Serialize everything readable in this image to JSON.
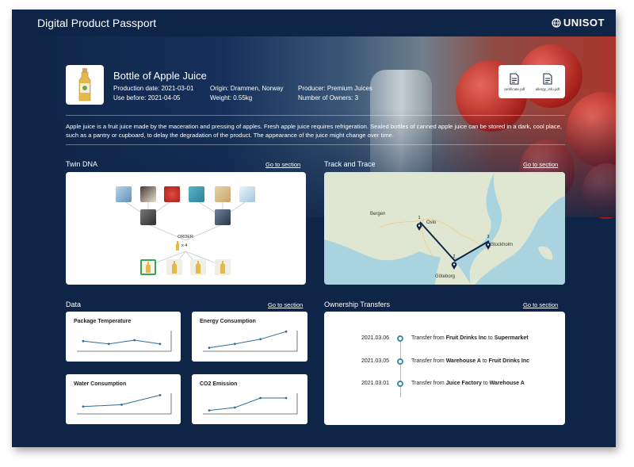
{
  "header": {
    "title": "Digital Product Passport",
    "brand": "UNISOT"
  },
  "product": {
    "name": "Bottle of Apple Juice",
    "production_date": "Production date: 2021-03-01",
    "use_before": "Use before: 2021-04-05",
    "origin": "Origin: Drammen, Norway",
    "weight": "Weight: 0.55kg",
    "producer": "Producer: Premium Juices",
    "owners": "Number of Owners: 3",
    "documents": [
      {
        "label": "certificate.pdf"
      },
      {
        "label": "allergy_info.pdf"
      }
    ],
    "description": "Apple juice is a fruit juice made by the maceration and pressing of apples. Fresh apple juice requires refrigeration. Sealed bottles of canned apple juice can be stored in a dark, cool place, such as a pantry or cupboard, to delay the degradation of the product. The appearance of the juice might change over time."
  },
  "twin_dna": {
    "title": "Twin DNA",
    "link": "Go to section",
    "order_label": "ORDER",
    "order_qty": "x 4"
  },
  "track": {
    "title": "Track and Trace",
    "link": "Go to section",
    "places": {
      "bergen": "Bergen",
      "oslo": "Oslo",
      "stockholm": "Stockholm",
      "goteborg": "Göteborg"
    },
    "stops": [
      "1",
      "2",
      "3"
    ]
  },
  "data_section": {
    "title": "Data",
    "link": "Go to section",
    "cards": [
      {
        "title": "Package Temperature",
        "values": [
          0.45,
          0.3,
          0.5,
          0.3
        ]
      },
      {
        "title": "Energy Consumption",
        "values": [
          0.1,
          0.3,
          0.55,
          0.95
        ]
      },
      {
        "title": "Water Consumption",
        "values": [
          0.3,
          0.4,
          0.9
        ]
      },
      {
        "title": "CO2 Emission",
        "values": [
          0.1,
          0.25,
          0.75,
          0.75
        ]
      }
    ]
  },
  "ownership": {
    "title": "Ownership Transfers",
    "link": "Go to section",
    "rows": [
      {
        "date": "2021.03.06",
        "prefix": "Transfer from ",
        "from": "Fruit Drinks Inc",
        "mid": " to ",
        "to": "Supermarket"
      },
      {
        "date": "2021.03.05",
        "prefix": "Transfer from ",
        "from": "Warehouse A",
        "mid": " to ",
        "to": "Fruit Drinks Inc"
      },
      {
        "date": "2021.03.01",
        "prefix": "Transfer from ",
        "from": "Juice Factory",
        "mid": " to ",
        "to": "Warehouse A"
      }
    ]
  },
  "colors": {
    "navy": "#0f2547",
    "accent": "#3e8fa6",
    "route": "#0f2547"
  }
}
